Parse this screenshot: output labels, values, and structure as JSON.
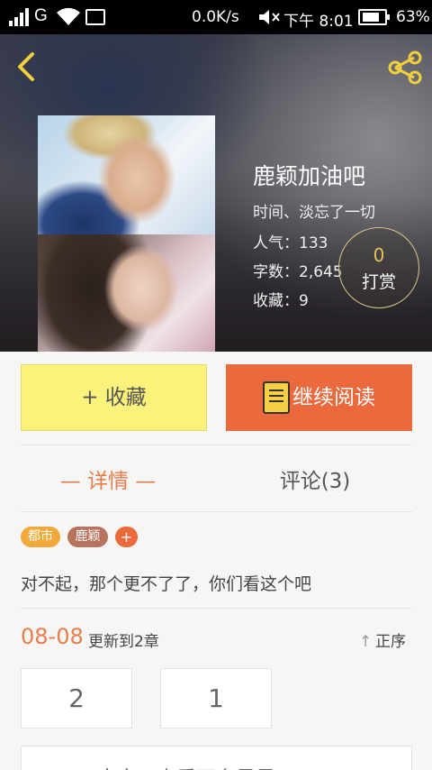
{
  "status_bar": {
    "carrier": "G",
    "speed": "0.0K/s",
    "time": "下午 8:01",
    "battery": "63%"
  },
  "header": {
    "back_icon": "chevron-left-icon",
    "share_icon": "share-icon",
    "accent": "#ea6a3d"
  },
  "book": {
    "title": "鹿颖加油吧",
    "author": "时间、淡忘了一切",
    "popularity": "人气：133",
    "word_count": "字数：2,645",
    "favorites": "收藏：9",
    "tip_count": "0",
    "tip_label": "打赏"
  },
  "actions": {
    "favorite_label": "+ 收藏",
    "read_label": "继续阅读"
  },
  "tabs": {
    "detail": "— 详情 —",
    "comments": "评论(3)"
  },
  "tags": [
    "都市",
    "鹿颖",
    "+"
  ],
  "description": "对不起，那个更不了了，你们看这个吧",
  "update": {
    "date": "08-08",
    "text": "更新到2章",
    "order": "正序"
  },
  "chapters": [
    "2",
    "1"
  ],
  "next_text": "大家，来看下多星星"
}
